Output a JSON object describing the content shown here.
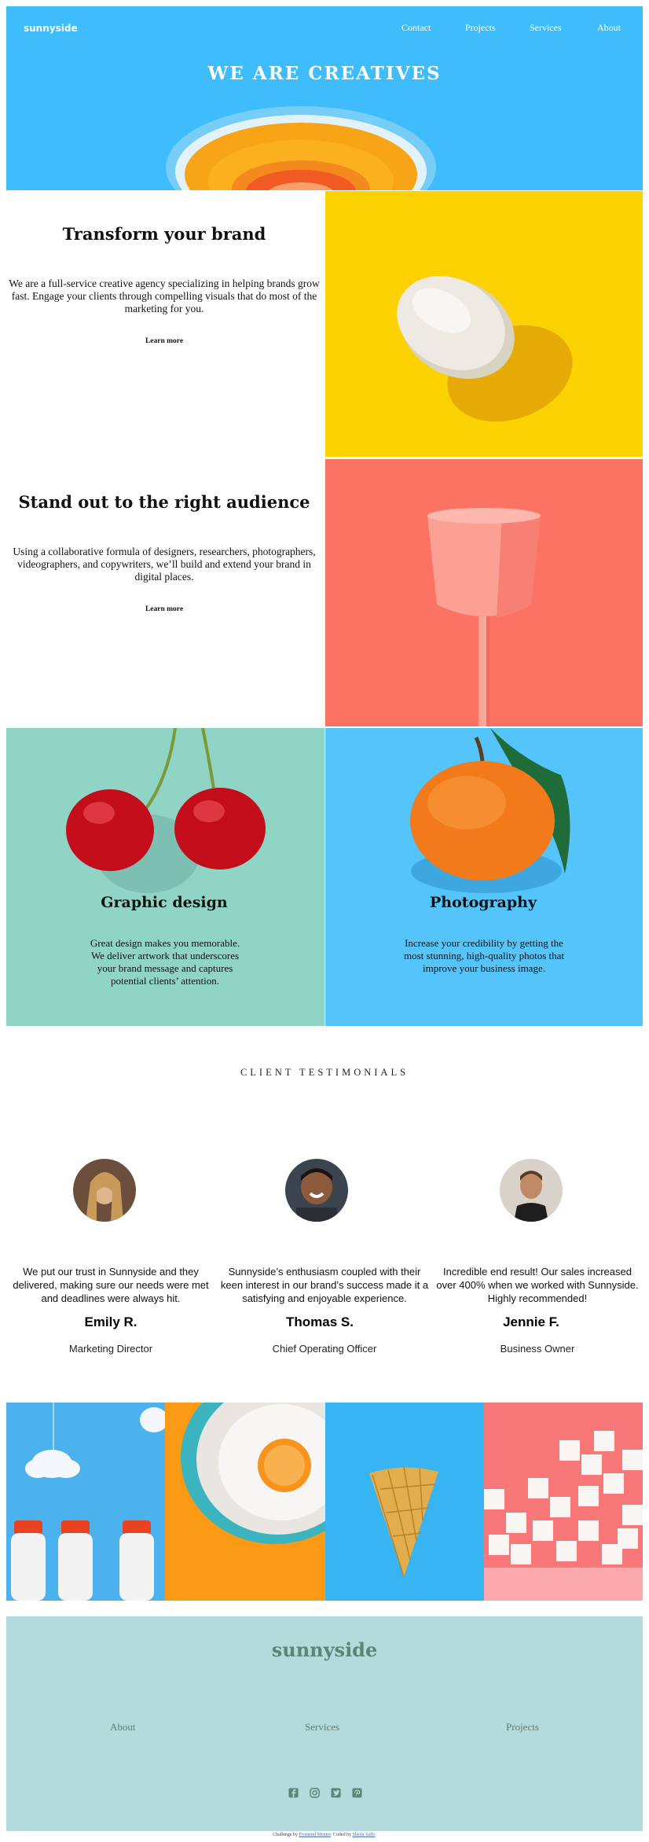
{
  "header": {
    "logo": "sunnyside",
    "nav": [
      "Contact",
      "Projects",
      "Services",
      "About"
    ],
    "hero_title": "WE ARE CREATIVES"
  },
  "features": [
    {
      "title": "Transform your brand",
      "body": "We are a full-service creative agency specializing in helping brands grow fast. Engage your clients through compelling visuals that do most of the marketing for you.",
      "link": "Learn more"
    },
    {
      "title": "Stand out to the right audience",
      "body": "Using a collaborative formula of designers, researchers, photographers, videographers, and copywriters, we’ll build and extend your brand in digital places.",
      "link": "Learn more"
    }
  ],
  "services": [
    {
      "title": "Graphic design",
      "body": "Great design makes you memorable. We deliver artwork that underscores your brand message and captures potential clients’ attention."
    },
    {
      "title": "Photography",
      "body": "Increase your credibility by getting the most stunning, high-quality photos that improve your business image."
    }
  ],
  "testimonials": {
    "heading": "CLIENT TESTIMONIALS",
    "items": [
      {
        "quote": "We put our trust in Sunnyside and they delivered, making sure our needs were met and deadlines were always hit.",
        "name": "Emily R.",
        "role": "Marketing Director"
      },
      {
        "quote": "Sunnyside’s enthusiasm coupled with their keen interest in our brand’s success made it a satisfying and enjoyable experience.",
        "name": "Thomas S.",
        "role": "Chief Operating Officer"
      },
      {
        "quote": "Incredible end result! Our sales increased over 400% when we worked with Sunnyside. Highly recommended!",
        "name": "Jennie F.",
        "role": "Business Owner"
      }
    ]
  },
  "footer": {
    "logo": "sunnyside",
    "links": [
      "About",
      "Services",
      "Projects"
    ],
    "social_icons": [
      "facebook-icon",
      "instagram-icon",
      "twitter-icon",
      "pinterest-icon"
    ],
    "attribution": {
      "prefix": "Challenge by ",
      "challenge_link": "Frontend Mentor",
      "middle": ". Coded by ",
      "author_link": "Sheila Sallo",
      "suffix": "."
    }
  },
  "colors": {
    "hero_blue": "#3ebcfb",
    "egg_yellow": "#fdd203",
    "cup_coral": "#fc7263",
    "cherry_teal": "#90d4c6",
    "orange_blue": "#55c4fa",
    "footer_teal": "#b4dbdb"
  }
}
